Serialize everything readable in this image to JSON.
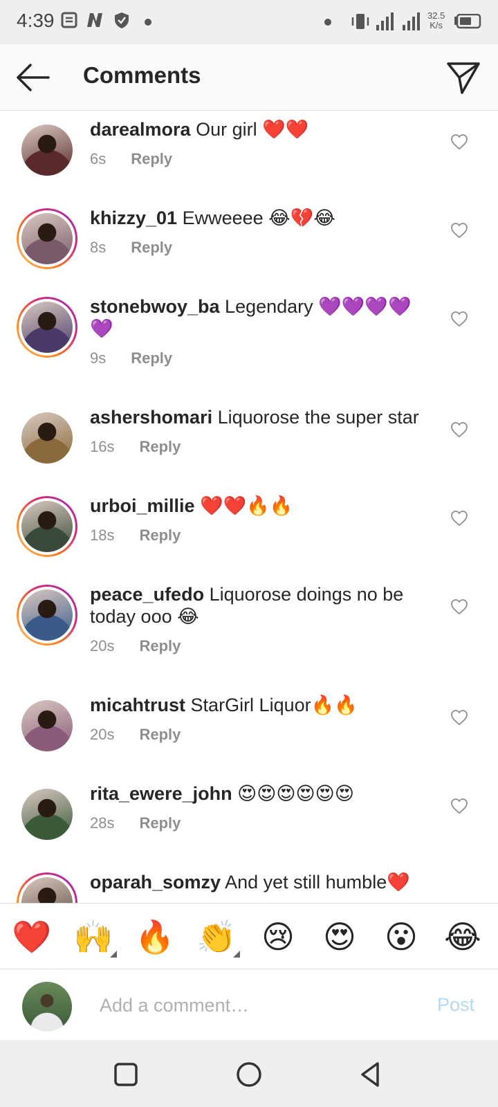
{
  "status_bar": {
    "time": "4:39",
    "speed_value": "32.5",
    "speed_unit": "K/s",
    "icons": [
      "notes-icon",
      "netflix-icon",
      "shield-icon",
      "dot-icon",
      "vibrate-icon",
      "signal-icon",
      "signal-icon",
      "battery-icon"
    ]
  },
  "header": {
    "title": "Comments"
  },
  "comments": [
    {
      "username": "darealmora",
      "text": "Our girl ❤️❤️",
      "time": "6s",
      "reply": "Reply",
      "story_ring": false,
      "avatar_color": "#5a2a2a"
    },
    {
      "username": "khizzy_01",
      "text": "Ewweeee 😂💔😂",
      "time": "8s",
      "reply": "Reply",
      "story_ring": true,
      "avatar_color": "#7a5a6a"
    },
    {
      "username": "stonebwoy_ba",
      "text": "Legendary 💜💜💜💜💜",
      "time": "9s",
      "reply": "Reply",
      "story_ring": true,
      "avatar_color": "#4a3a6a"
    },
    {
      "username": "ashershomari",
      "text": "Liquorose the super star",
      "time": "16s",
      "reply": "Reply",
      "story_ring": false,
      "avatar_color": "#8a6a3a"
    },
    {
      "username": "urboi_millie",
      "text": "❤️❤️🔥🔥",
      "time": "18s",
      "reply": "Reply",
      "story_ring": true,
      "avatar_color": "#3a4a3a"
    },
    {
      "username": "peace_ufedo",
      "text": "Liquorose doings no be today ooo 😂",
      "time": "20s",
      "reply": "Reply",
      "story_ring": true,
      "avatar_color": "#3a5a8a"
    },
    {
      "username": "micahtrust",
      "text": "StarGirl Liquor🔥🔥",
      "time": "20s",
      "reply": "Reply",
      "story_ring": false,
      "avatar_color": "#8a5a7a"
    },
    {
      "username": "rita_ewere_john",
      "text": "😍😍😍😍😍😍",
      "time": "28s",
      "reply": "Reply",
      "story_ring": false,
      "avatar_color": "#3a5a3a"
    },
    {
      "username": "oparah_somzy",
      "text": "And yet still humble❤️",
      "time": "",
      "reply": "",
      "story_ring": true,
      "avatar_color": "#5a4a3a"
    }
  ],
  "reactions": [
    "❤️",
    "🙌",
    "🔥",
    "👏",
    "😢",
    "😍",
    "😮",
    "😂"
  ],
  "input": {
    "placeholder": "Add a comment…",
    "post_label": "Post"
  },
  "colors": {
    "post_disabled": "#b3d8f8",
    "meta_gray": "#8e8e8e",
    "story_ring": [
      "#fdc468",
      "#fa7e1e",
      "#d62976",
      "#962fbf"
    ]
  }
}
